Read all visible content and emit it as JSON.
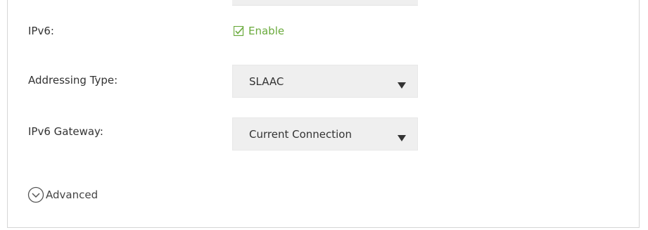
{
  "form": {
    "ipv6": {
      "label": "IPv6:",
      "checkbox_checked": true,
      "checkbox_label": "Enable"
    },
    "addressing_type": {
      "label": "Addressing Type:",
      "value": "SLAAC"
    },
    "ipv6_gateway": {
      "label": "IPv6 Gateway:",
      "value": "Current Connection"
    },
    "advanced": {
      "label": "Advanced"
    }
  },
  "icons": {
    "checkbox": "checkbox-checked-icon",
    "dropdown": "triangle-down-icon",
    "advanced": "chevron-down-circle-icon"
  },
  "colors": {
    "accent_green": "#6aaa3c",
    "field_background": "#efefef",
    "border": "#d6d6d6",
    "text": "#333333"
  }
}
